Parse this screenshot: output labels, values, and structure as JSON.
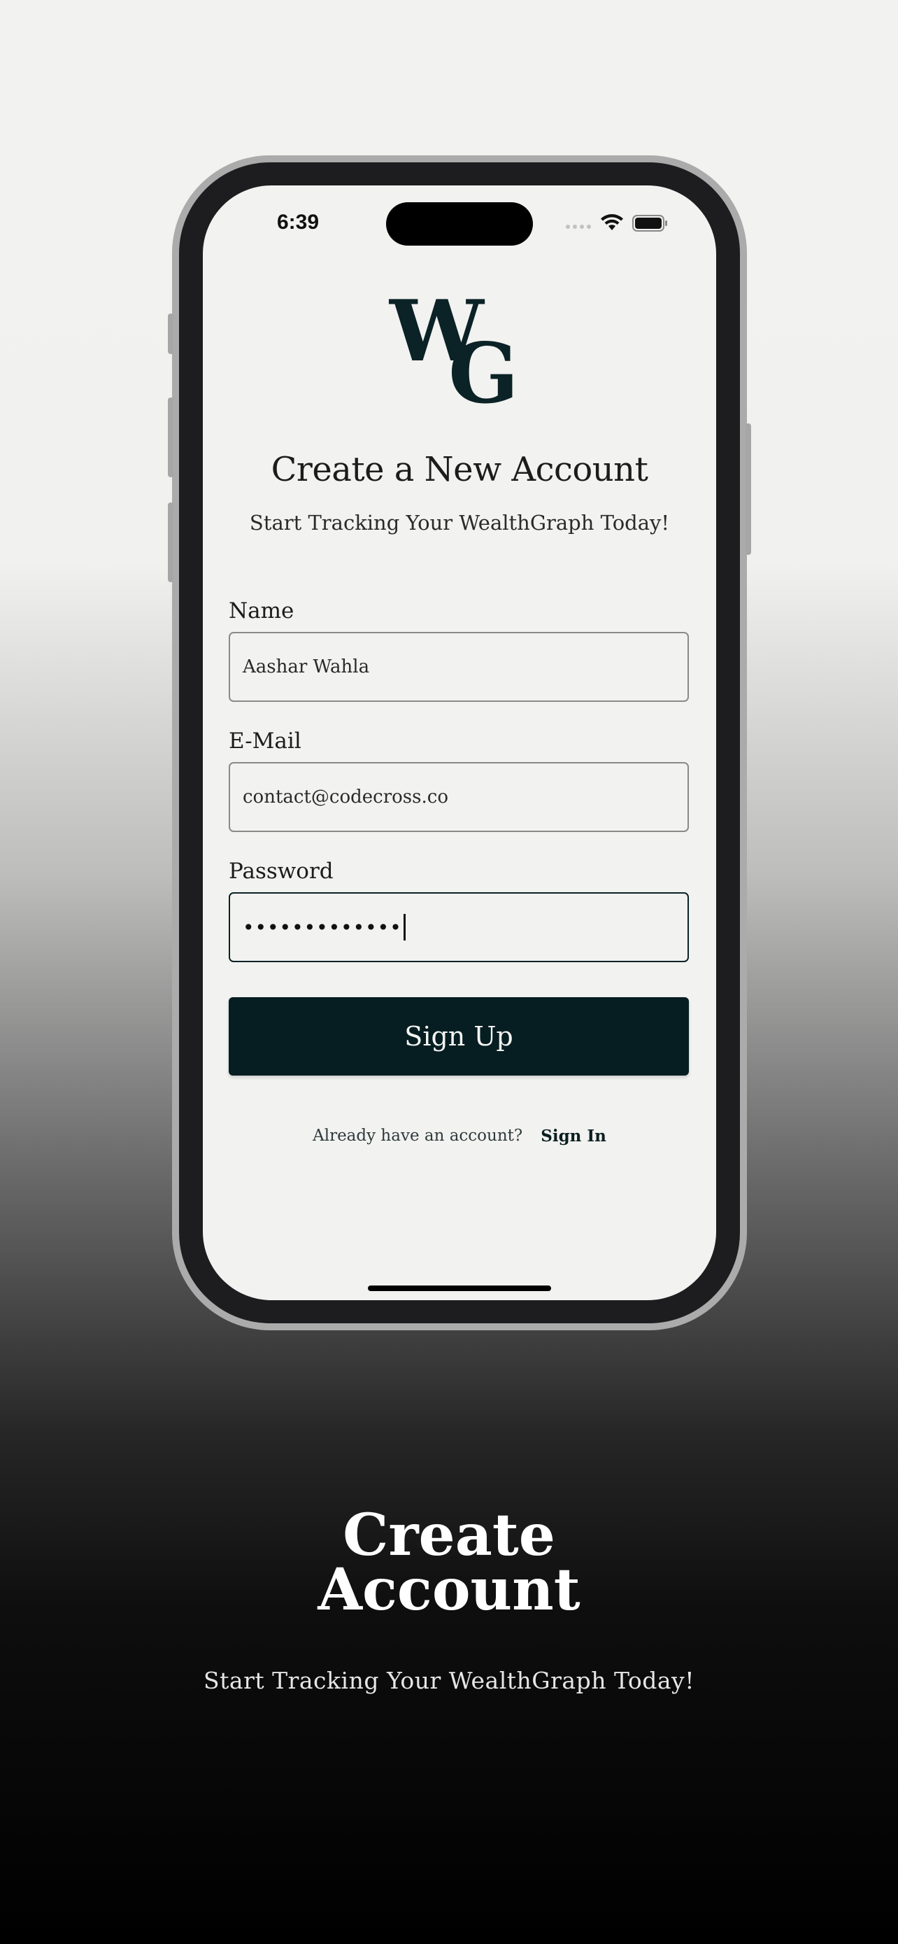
{
  "status_bar": {
    "time": "6:39",
    "icons": [
      "signal-icon",
      "wifi-icon",
      "battery-icon"
    ]
  },
  "brand": {
    "logo_letters": "WG",
    "color": "#0b2226"
  },
  "header": {
    "title": "Create a New Account",
    "subtitle": "Start Tracking Your WealthGraph Today!"
  },
  "form": {
    "name": {
      "label": "Name",
      "value": "Aashar Wahla"
    },
    "email": {
      "label": "E-Mail",
      "value": "contact@codecross.co"
    },
    "password": {
      "label": "Password",
      "value": "•••••••••••••"
    },
    "submit_label": "Sign Up"
  },
  "footer": {
    "prompt": "Already have an account?",
    "link": "Sign In"
  },
  "promo": {
    "title_line1": "Create",
    "title_line2": "Account",
    "subtitle": "Start Tracking Your WealthGraph Today!"
  },
  "colors": {
    "primary": "#061e22",
    "screen_bg": "#f2f2f0"
  }
}
